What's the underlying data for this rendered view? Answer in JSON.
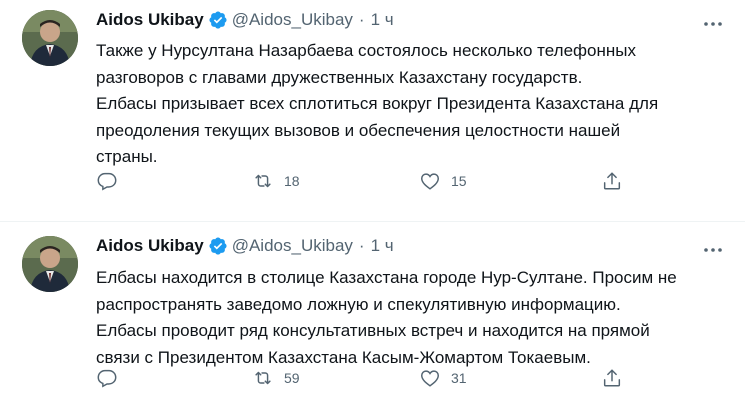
{
  "tweets": [
    {
      "author_name": "Aidos Ukibay",
      "author_handle": "@Aidos_Ukibay",
      "separator": "·",
      "time": "1 ч",
      "lines": [
        "Также у Нурсултана Назарбаева состоялось несколько телефонных",
        "разговоров с главами дружественных Казахстану государств.",
        "Елбасы призывает всех сплотиться вокруг Президента Казахстана для",
        "преодоления текущих вызовов и обеспечения целостности нашей",
        "страны."
      ],
      "retweets": "18",
      "likes": "15"
    },
    {
      "author_name": "Aidos Ukibay",
      "author_handle": "@Aidos_Ukibay",
      "separator": "·",
      "time": "1 ч",
      "lines": [
        "Елбасы находится в столице Казахстана городе Нур-Султане. Просим не",
        "распространять заведомо ложную и спекулятивную информацию.",
        "Елбасы проводит ряд консультативных встреч и находится на прямой",
        "связи с Президентом Казахстана Касым-Жомартом Токаевым."
      ],
      "retweets": "59",
      "likes": "31"
    }
  ],
  "icons": {
    "verified": "verified-badge-icon",
    "more": "more-options-icon",
    "reply": "reply-icon",
    "retweet": "retweet-icon",
    "like": "like-icon",
    "share": "share-icon"
  },
  "colors": {
    "text": "#0f1419",
    "secondary": "#536471",
    "verified": "#1d9bf0",
    "divider": "#eff3f4"
  }
}
